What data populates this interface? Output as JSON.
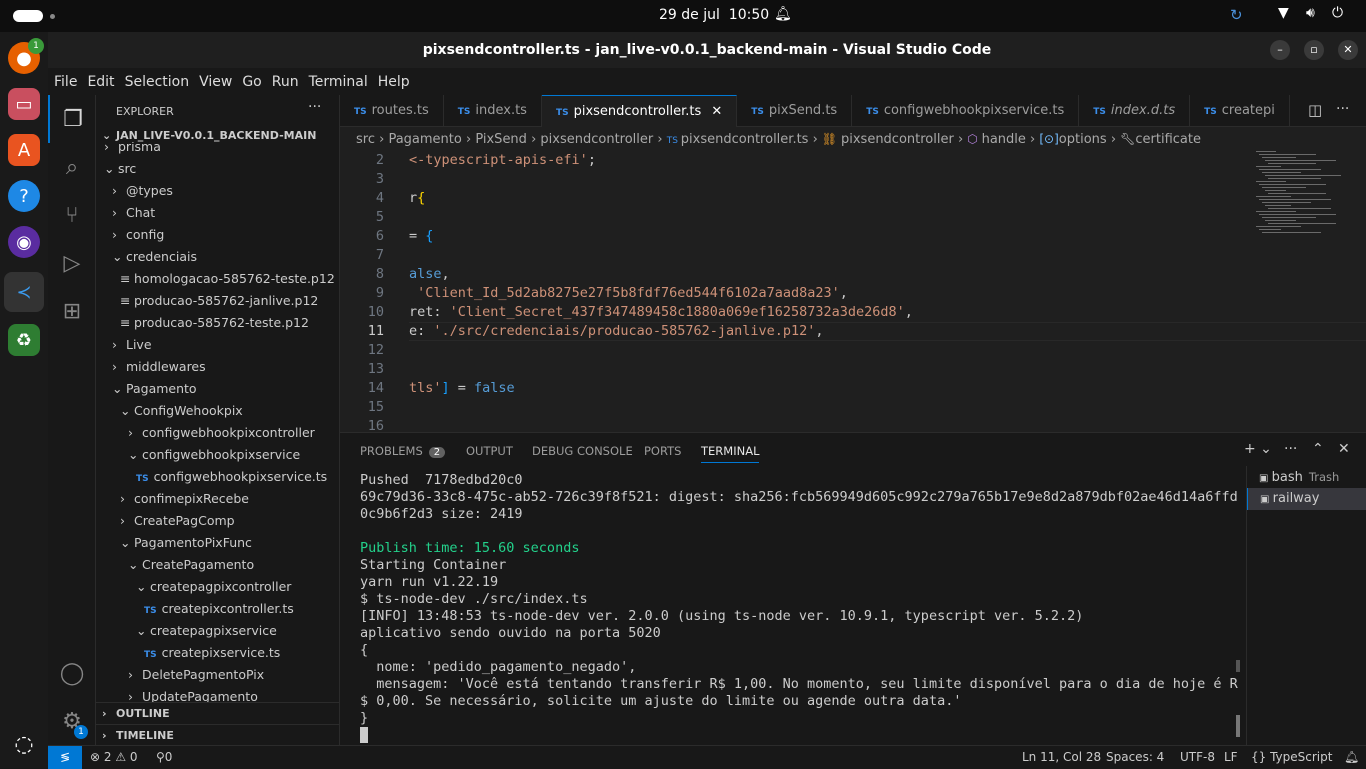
{
  "system": {
    "date": "29 de jul",
    "time": "10:50"
  },
  "dock": {
    "badge_firefox": "1",
    "badge_settings": "1"
  },
  "window": {
    "title": "pixsendcontroller.ts - jan_live-v0.0.1_backend-main - Visual Studio Code"
  },
  "menu": [
    "File",
    "Edit",
    "Selection",
    "View",
    "Go",
    "Run",
    "Terminal",
    "Help"
  ],
  "explorer": {
    "title": "EXPLORER",
    "root": "JAN_LIVE-V0.0.1_BACKEND-MAIN",
    "items": [
      {
        "label": "prisma",
        "depth": 1,
        "type": "folder-closed"
      },
      {
        "label": "src",
        "depth": 1,
        "type": "folder-open"
      },
      {
        "label": "@types",
        "depth": 2,
        "type": "folder-closed"
      },
      {
        "label": "Chat",
        "depth": 2,
        "type": "folder-closed"
      },
      {
        "label": "config",
        "depth": 2,
        "type": "folder-closed"
      },
      {
        "label": "credenciais",
        "depth": 2,
        "type": "folder-open"
      },
      {
        "label": "homologacao-585762-teste.p12",
        "depth": 3,
        "type": "file"
      },
      {
        "label": "producao-585762-janlive.p12",
        "depth": 3,
        "type": "file"
      },
      {
        "label": "producao-585762-teste.p12",
        "depth": 3,
        "type": "file"
      },
      {
        "label": "Live",
        "depth": 2,
        "type": "folder-closed"
      },
      {
        "label": "middlewares",
        "depth": 2,
        "type": "folder-closed"
      },
      {
        "label": "Pagamento",
        "depth": 2,
        "type": "folder-open"
      },
      {
        "label": "ConfigWehookpix",
        "depth": 3,
        "type": "folder-open"
      },
      {
        "label": "configwebhookpixcontroller",
        "depth": 4,
        "type": "folder-closed"
      },
      {
        "label": "configwebhookpixservice",
        "depth": 4,
        "type": "folder-open"
      },
      {
        "label": "configwebhookpixservice.ts",
        "depth": 5,
        "type": "ts"
      },
      {
        "label": "confimepixRecebe",
        "depth": 3,
        "type": "folder-closed"
      },
      {
        "label": "CreatePagComp",
        "depth": 3,
        "type": "folder-closed"
      },
      {
        "label": "PagamentoPixFunc",
        "depth": 3,
        "type": "folder-open"
      },
      {
        "label": "CreatePagamento",
        "depth": 4,
        "type": "folder-open"
      },
      {
        "label": "createpagpixcontroller",
        "depth": 5,
        "type": "folder-open"
      },
      {
        "label": "createpixcontroller.ts",
        "depth": 6,
        "type": "ts"
      },
      {
        "label": "createpagpixservice",
        "depth": 5,
        "type": "folder-open"
      },
      {
        "label": "createpixservice.ts",
        "depth": 6,
        "type": "ts"
      },
      {
        "label": "DeletePagmentoPix",
        "depth": 4,
        "type": "folder-closed"
      },
      {
        "label": "UpdatePagamento",
        "depth": 4,
        "type": "folder-closed"
      }
    ],
    "outline": "OUTLINE",
    "timeline": "TIMELINE"
  },
  "tabs": [
    {
      "label": "routes.ts",
      "active": false
    },
    {
      "label": "index.ts",
      "active": false
    },
    {
      "label": "pixsendcontroller.ts",
      "active": true
    },
    {
      "label": "pixSend.ts",
      "active": false
    },
    {
      "label": "configwebhookpixservice.ts",
      "active": false
    },
    {
      "label": "index.d.ts",
      "active": false
    },
    {
      "label": "createpi",
      "active": false
    }
  ],
  "breadcrumb": [
    "src",
    "Pagamento",
    "PixSend",
    "pixsendcontroller",
    "pixsendcontroller.ts",
    "pixsendcontroller",
    "handle",
    "options",
    "certificate"
  ],
  "editor": {
    "current_line": "11",
    "lines": [
      {
        "n": "2",
        "html": [
          [
            "s",
            "<-typescript-apis-efi'"
          ],
          [
            "p",
            ";"
          ]
        ]
      },
      {
        "n": "3",
        "html": []
      },
      {
        "n": "4",
        "html": [
          [
            "p",
            "r"
          ],
          [
            "b",
            "{"
          ]
        ]
      },
      {
        "n": "5",
        "html": []
      },
      {
        "n": "6",
        "html": [
          [
            "p",
            "= "
          ],
          [
            "bb",
            "{"
          ]
        ]
      },
      {
        "n": "7",
        "html": []
      },
      {
        "n": "8",
        "html": [
          [
            "k",
            "alse"
          ],
          [
            "p",
            ","
          ]
        ]
      },
      {
        "n": "9",
        "html": [
          [
            "p",
            " "
          ],
          [
            "s",
            "'Client_Id_5d2ab8275e27f5b8fdf76ed544f6102a7aad8a23'"
          ],
          [
            "p",
            ","
          ]
        ]
      },
      {
        "n": "10",
        "html": [
          [
            "p",
            "ret: "
          ],
          [
            "s",
            "'Client_Secret_437f347489458c1880a069ef16258732a3de26d8'"
          ],
          [
            "p",
            ","
          ]
        ]
      },
      {
        "n": "11",
        "html": [
          [
            "p",
            "e: "
          ],
          [
            "s",
            "'./src/credenciais/producao-585762-janlive.p12'"
          ],
          [
            "p",
            ","
          ]
        ]
      },
      {
        "n": "12",
        "html": []
      },
      {
        "n": "13",
        "html": []
      },
      {
        "n": "14",
        "html": [
          [
            "s",
            "tls'"
          ],
          [
            "bb",
            "]"
          ],
          [
            "p",
            " = "
          ],
          [
            "k",
            "false"
          ]
        ]
      },
      {
        "n": "15",
        "html": []
      },
      {
        "n": "16",
        "html": []
      }
    ]
  },
  "panel": {
    "tabs": [
      "PROBLEMS",
      "OUTPUT",
      "DEBUG CONSOLE",
      "PORTS",
      "TERMINAL"
    ],
    "problems_count": "2",
    "active": "TERMINAL"
  },
  "terminal": {
    "lines": [
      {
        "t": "Pushed  7178edbd20c0",
        "c": "#cccccc"
      },
      {
        "t": "69c79d36-33c8-475c-ab52-726c39f8f521: digest: sha256:fcb569949d605c992c279a765b17e9e8d2a879dbf02ae46d14a6ffd",
        "c": "#cccccc"
      },
      {
        "t": "0c9b6f2d3 size: 2419",
        "c": "#cccccc"
      },
      {
        "t": "",
        "c": "#cccccc"
      },
      {
        "t": "Publish time: 15.60 seconds",
        "c": "#23d18b"
      },
      {
        "t": "Starting Container",
        "c": "#cccccc"
      },
      {
        "t": "yarn run v1.22.19",
        "c": "#cccccc"
      },
      {
        "t": "$ ts-node-dev ./src/index.ts",
        "c": "#cccccc"
      },
      {
        "t": "[INFO] 13:48:53 ts-node-dev ver. 2.0.0 (using ts-node ver. 10.9.1, typescript ver. 5.2.2)",
        "c": "#cccccc"
      },
      {
        "t": "aplicativo sendo ouvido na porta 5020",
        "c": "#cccccc"
      },
      {
        "t": "{",
        "c": "#cccccc"
      },
      {
        "t": "  nome: 'pedido_pagamento_negado',",
        "c": "#cccccc"
      },
      {
        "t": "  mensagem: 'Você está tentando transferir R$ 1,00. No momento, seu limite disponível para o dia de hoje é R",
        "c": "#cccccc"
      },
      {
        "t": "$ 0,00. Se necessário, solicite um ajuste do limite ou agende outra data.'",
        "c": "#cccccc"
      },
      {
        "t": "}",
        "c": "#cccccc"
      }
    ],
    "sessions": [
      {
        "label": "bash",
        "extra": "Trash"
      },
      {
        "label": "railway",
        "extra": ""
      }
    ]
  },
  "status": {
    "errors": "2",
    "warnings": "0",
    "ports": "0",
    "position": "Ln 11, Col 28",
    "spaces": "Spaces: 4",
    "encoding": "UTF-8",
    "eol": "LF",
    "language": "TypeScript"
  },
  "colors": {
    "accent": "#0078d4",
    "string": "#ce9178",
    "keyword": "#569cd6",
    "success": "#23d18b"
  }
}
